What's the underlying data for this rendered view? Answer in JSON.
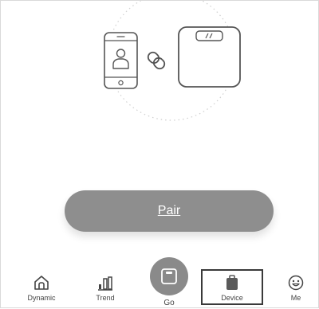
{
  "pair_button": {
    "label": "Pair"
  },
  "tabs": [
    {
      "id": "dynamic",
      "label": "Dynamic",
      "icon": "home-icon"
    },
    {
      "id": "trend",
      "label": "Trend",
      "icon": "bar-chart-icon"
    },
    {
      "id": "go",
      "label": "Go",
      "icon": "scale-icon"
    },
    {
      "id": "device",
      "label": "Device",
      "icon": "device-bag-icon"
    },
    {
      "id": "me",
      "label": "Me",
      "icon": "smiley-face-icon"
    }
  ],
  "colors": {
    "button": "#8e8e8e",
    "active_circle": "#8a8a8a",
    "icon": "#444444",
    "outline": "#3a3a3a"
  }
}
